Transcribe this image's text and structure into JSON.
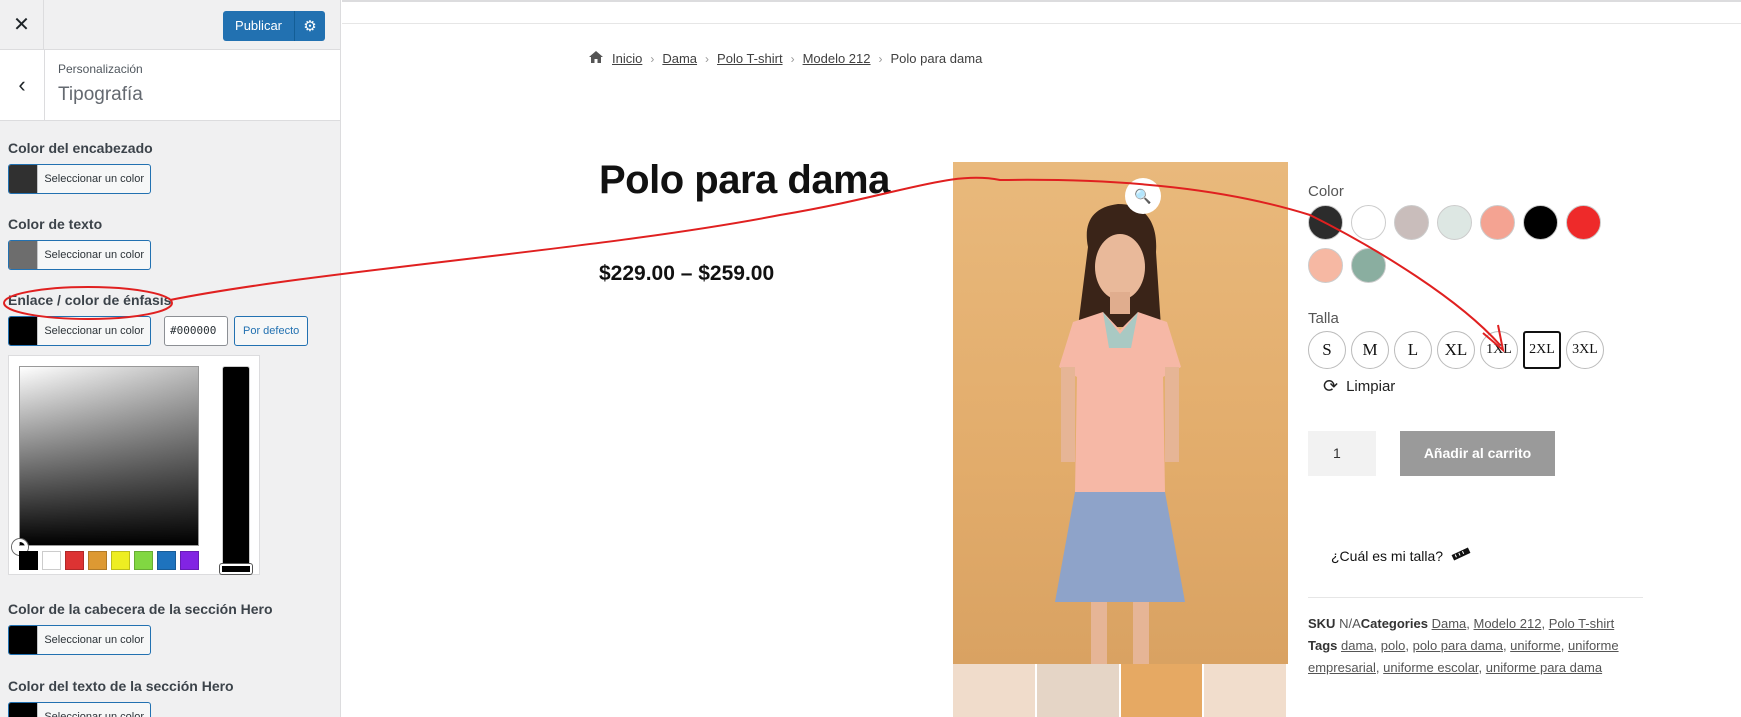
{
  "customizer": {
    "close_icon": "close-icon",
    "publish_label": "Publicar",
    "gear_icon": "gear-icon",
    "breadcrumb": "Personalización",
    "section_title": "Tipografía",
    "back_icon": "chevron-left-icon",
    "controls": [
      {
        "label": "Color del encabezado",
        "button": "Seleccionar un color",
        "swatch": "#303030"
      },
      {
        "label": "Color de texto",
        "button": "Seleccionar un color",
        "swatch": "#6d6d6d"
      },
      {
        "label": "Enlace / color de énfasis",
        "button": "Seleccionar un color",
        "swatch": "#000000",
        "hex": "#000000",
        "default_button": "Por defecto"
      },
      {
        "label": "Color de la cabecera de la sección Hero",
        "button": "Seleccionar un color",
        "swatch": "#000000"
      },
      {
        "label": "Color del texto de la sección Hero",
        "button": "Seleccionar un color",
        "swatch": "#000000"
      }
    ],
    "palette": [
      "#000000",
      "#ffffff",
      "#dd3333",
      "#dd9933",
      "#eeee22",
      "#81d742",
      "#1e73be",
      "#8224e3"
    ]
  },
  "preview": {
    "breadcrumb": [
      "Inicio",
      "Dama",
      "Polo T-shirt",
      "Modelo 212",
      "Polo para dama"
    ],
    "title": "Polo para dama",
    "price": "$229.00 – $259.00",
    "color_label": "Color",
    "color_swatches": [
      "#2c2c2c",
      "#ffffff",
      "#c9bdbb",
      "#dde7e3",
      "#f4a392",
      "#000000",
      "#ee2a2a",
      "#f6b8a3",
      "#8aaea0"
    ],
    "size_label": "Talla",
    "sizes": [
      "S",
      "M",
      "L",
      "XL",
      "1XL",
      "2XL",
      "3XL"
    ],
    "selected_size": "2XL",
    "reset_label": "Limpiar",
    "qty": "1",
    "add_to_cart": "Añadir al carrito",
    "size_guide": "¿Cuál es mi talla?",
    "meta": {
      "sku_label": "SKU",
      "sku_value": "N/A",
      "categories_label": "Categories",
      "categories": [
        "Dama",
        "Modelo 212",
        "Polo T-shirt"
      ],
      "tags_label": "Tags",
      "tags": [
        "dama",
        "polo",
        "polo para dama",
        "uniforme",
        "uniforme empresarial",
        "uniforme escolar",
        "uniforme para dama"
      ]
    }
  },
  "colors": {
    "wp_blue": "#2271b1",
    "annotation_red": "#e02020",
    "photo_background": "#e2ac6b"
  }
}
